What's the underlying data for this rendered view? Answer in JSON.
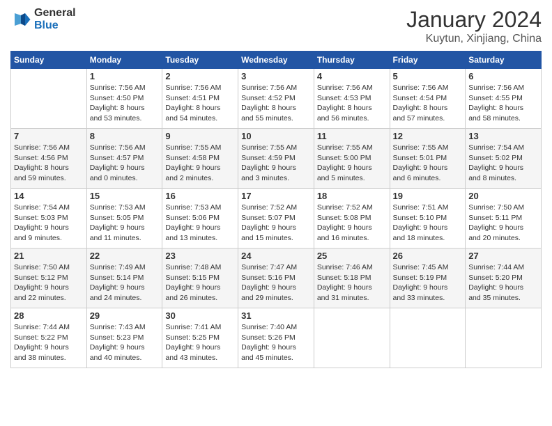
{
  "header": {
    "logo": {
      "general": "General",
      "blue": "Blue"
    },
    "title": "January 2024",
    "subtitle": "Kuytun, Xinjiang, China"
  },
  "weekdays": [
    "Sunday",
    "Monday",
    "Tuesday",
    "Wednesday",
    "Thursday",
    "Friday",
    "Saturday"
  ],
  "weeks": [
    [
      {
        "day": null,
        "info": null
      },
      {
        "day": "1",
        "info": "Sunrise: 7:56 AM\nSunset: 4:50 PM\nDaylight: 8 hours\nand 53 minutes."
      },
      {
        "day": "2",
        "info": "Sunrise: 7:56 AM\nSunset: 4:51 PM\nDaylight: 8 hours\nand 54 minutes."
      },
      {
        "day": "3",
        "info": "Sunrise: 7:56 AM\nSunset: 4:52 PM\nDaylight: 8 hours\nand 55 minutes."
      },
      {
        "day": "4",
        "info": "Sunrise: 7:56 AM\nSunset: 4:53 PM\nDaylight: 8 hours\nand 56 minutes."
      },
      {
        "day": "5",
        "info": "Sunrise: 7:56 AM\nSunset: 4:54 PM\nDaylight: 8 hours\nand 57 minutes."
      },
      {
        "day": "6",
        "info": "Sunrise: 7:56 AM\nSunset: 4:55 PM\nDaylight: 8 hours\nand 58 minutes."
      }
    ],
    [
      {
        "day": "7",
        "info": "Sunrise: 7:56 AM\nSunset: 4:56 PM\nDaylight: 8 hours\nand 59 minutes."
      },
      {
        "day": "8",
        "info": "Sunrise: 7:56 AM\nSunset: 4:57 PM\nDaylight: 9 hours\nand 0 minutes."
      },
      {
        "day": "9",
        "info": "Sunrise: 7:55 AM\nSunset: 4:58 PM\nDaylight: 9 hours\nand 2 minutes."
      },
      {
        "day": "10",
        "info": "Sunrise: 7:55 AM\nSunset: 4:59 PM\nDaylight: 9 hours\nand 3 minutes."
      },
      {
        "day": "11",
        "info": "Sunrise: 7:55 AM\nSunset: 5:00 PM\nDaylight: 9 hours\nand 5 minutes."
      },
      {
        "day": "12",
        "info": "Sunrise: 7:55 AM\nSunset: 5:01 PM\nDaylight: 9 hours\nand 6 minutes."
      },
      {
        "day": "13",
        "info": "Sunrise: 7:54 AM\nSunset: 5:02 PM\nDaylight: 9 hours\nand 8 minutes."
      }
    ],
    [
      {
        "day": "14",
        "info": "Sunrise: 7:54 AM\nSunset: 5:03 PM\nDaylight: 9 hours\nand 9 minutes."
      },
      {
        "day": "15",
        "info": "Sunrise: 7:53 AM\nSunset: 5:05 PM\nDaylight: 9 hours\nand 11 minutes."
      },
      {
        "day": "16",
        "info": "Sunrise: 7:53 AM\nSunset: 5:06 PM\nDaylight: 9 hours\nand 13 minutes."
      },
      {
        "day": "17",
        "info": "Sunrise: 7:52 AM\nSunset: 5:07 PM\nDaylight: 9 hours\nand 15 minutes."
      },
      {
        "day": "18",
        "info": "Sunrise: 7:52 AM\nSunset: 5:08 PM\nDaylight: 9 hours\nand 16 minutes."
      },
      {
        "day": "19",
        "info": "Sunrise: 7:51 AM\nSunset: 5:10 PM\nDaylight: 9 hours\nand 18 minutes."
      },
      {
        "day": "20",
        "info": "Sunrise: 7:50 AM\nSunset: 5:11 PM\nDaylight: 9 hours\nand 20 minutes."
      }
    ],
    [
      {
        "day": "21",
        "info": "Sunrise: 7:50 AM\nSunset: 5:12 PM\nDaylight: 9 hours\nand 22 minutes."
      },
      {
        "day": "22",
        "info": "Sunrise: 7:49 AM\nSunset: 5:14 PM\nDaylight: 9 hours\nand 24 minutes."
      },
      {
        "day": "23",
        "info": "Sunrise: 7:48 AM\nSunset: 5:15 PM\nDaylight: 9 hours\nand 26 minutes."
      },
      {
        "day": "24",
        "info": "Sunrise: 7:47 AM\nSunset: 5:16 PM\nDaylight: 9 hours\nand 29 minutes."
      },
      {
        "day": "25",
        "info": "Sunrise: 7:46 AM\nSunset: 5:18 PM\nDaylight: 9 hours\nand 31 minutes."
      },
      {
        "day": "26",
        "info": "Sunrise: 7:45 AM\nSunset: 5:19 PM\nDaylight: 9 hours\nand 33 minutes."
      },
      {
        "day": "27",
        "info": "Sunrise: 7:44 AM\nSunset: 5:20 PM\nDaylight: 9 hours\nand 35 minutes."
      }
    ],
    [
      {
        "day": "28",
        "info": "Sunrise: 7:44 AM\nSunset: 5:22 PM\nDaylight: 9 hours\nand 38 minutes."
      },
      {
        "day": "29",
        "info": "Sunrise: 7:43 AM\nSunset: 5:23 PM\nDaylight: 9 hours\nand 40 minutes."
      },
      {
        "day": "30",
        "info": "Sunrise: 7:41 AM\nSunset: 5:25 PM\nDaylight: 9 hours\nand 43 minutes."
      },
      {
        "day": "31",
        "info": "Sunrise: 7:40 AM\nSunset: 5:26 PM\nDaylight: 9 hours\nand 45 minutes."
      },
      {
        "day": null,
        "info": null
      },
      {
        "day": null,
        "info": null
      },
      {
        "day": null,
        "info": null
      }
    ]
  ]
}
